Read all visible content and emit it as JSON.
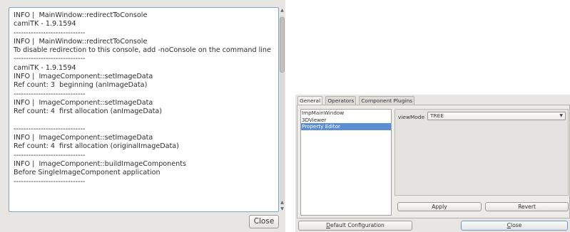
{
  "console": {
    "log_lines": [
      "INFO |  MainWindow::redirectToConsole",
      "camiTK - 1.9.1594",
      "-----------------------------",
      "INFO |  MainWindow::redirectToConsole",
      "To disable redirection to this console, add -noConsole on the command line",
      "-----------------------------",
      "camiTK - 1.9.1594",
      "INFO |  ImageComponent::setImageData",
      "Ref count: 3  beginning (anImageData)",
      "-----------------------------",
      "INFO |  ImageComponent::setImageData",
      "Ref count: 4  first allocation (anImageData)",
      "",
      "-----------------------------",
      "INFO |  ImageComponent::setImageData",
      "Ref count: 4  first allocation (originalImageData)",
      "-----------------------------",
      "INFO |  ImageComponent::buildImageComponents",
      "Before SingleImageComponent application",
      "-----------------------------"
    ],
    "close_label": "Close"
  },
  "settings": {
    "tabs": [
      "General",
      "Operators",
      "Component Plugins"
    ],
    "active_tab": "General",
    "viewers": [
      "ImpMainWindow",
      "3DViewer",
      "Property Editor"
    ],
    "selected_viewer": "Property Editor",
    "property_label": "viewMode",
    "property_value": "TREE",
    "apply_label": "Apply",
    "revert_label": "Revert",
    "default_config_label": "Default Configuration",
    "close_label": "Close",
    "selection_color": "#5b8ed4",
    "focus_border_color": "#7fa3c8"
  }
}
